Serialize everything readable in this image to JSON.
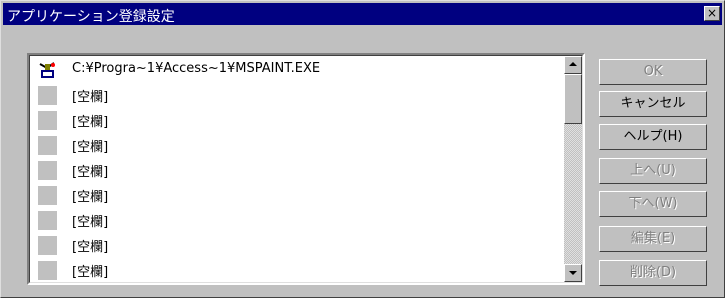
{
  "window": {
    "title": "アプリケーション登録設定",
    "close_label": "×"
  },
  "list": {
    "items": [
      {
        "text": "C:¥Progra~1¥Access~1¥MSPAINT.EXE",
        "icon": "paint-app-icon"
      },
      {
        "text": "[空欄]",
        "icon": "blank-icon"
      },
      {
        "text": "[空欄]",
        "icon": "blank-icon"
      },
      {
        "text": "[空欄]",
        "icon": "blank-icon"
      },
      {
        "text": "[空欄]",
        "icon": "blank-icon"
      },
      {
        "text": "[空欄]",
        "icon": "blank-icon"
      },
      {
        "text": "[空欄]",
        "icon": "blank-icon"
      },
      {
        "text": "[空欄]",
        "icon": "blank-icon"
      },
      {
        "text": "[空欄]",
        "icon": "blank-icon"
      }
    ]
  },
  "buttons": {
    "ok": "OK",
    "cancel": "キャンセル",
    "help": "ヘルプ(H)",
    "up": "上へ(U)",
    "down": "下へ(W)",
    "edit": "編集(E)",
    "delete": "削除(D)"
  }
}
